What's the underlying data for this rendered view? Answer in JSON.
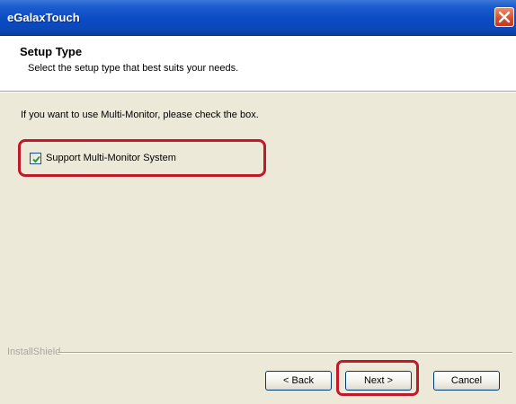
{
  "window": {
    "title": "eGalaxTouch"
  },
  "header": {
    "title": "Setup Type",
    "subtitle": "Select the setup type that best suits your needs."
  },
  "main": {
    "instruction": "If you want to use Multi-Monitor, please check the box.",
    "checkbox": {
      "label": "Support Multi-Monitor System",
      "checked": true
    }
  },
  "footer": {
    "brand": "InstallShield",
    "back_label": "< Back",
    "next_label": "Next >",
    "cancel_label": "Cancel"
  },
  "colors": {
    "highlight": "#c0192a",
    "titlebar": "#0a4bc4"
  }
}
